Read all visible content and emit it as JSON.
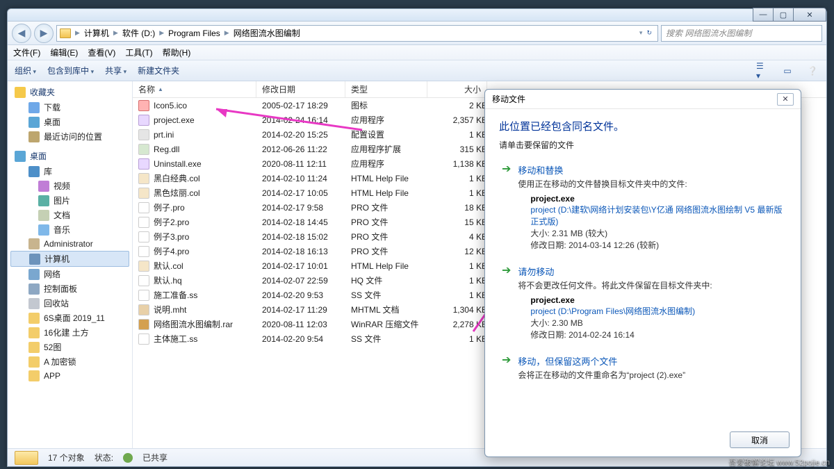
{
  "window_controls": {
    "min": "—",
    "max": "▢",
    "close": "✕"
  },
  "breadcrumbs": [
    "计算机",
    "软件 (D:)",
    "Program Files",
    "网络图流水图编制"
  ],
  "search_placeholder": "搜索 网络图流水图编制",
  "menu": {
    "file": "文件(F)",
    "edit": "编辑(E)",
    "view": "查看(V)",
    "tools": "工具(T)",
    "help": "帮助(H)"
  },
  "toolbar": {
    "organize": "组织",
    "include": "包含到库中",
    "share": "共享",
    "newfolder": "新建文件夹"
  },
  "sidebar": {
    "favorites": "收藏夹",
    "downloads": "下载",
    "desktop": "桌面",
    "recent": "最近访问的位置",
    "desktop_hdr": "桌面",
    "library": "库",
    "video": "视频",
    "pictures": "图片",
    "documents": "文档",
    "music": "音乐",
    "admin": "Administrator",
    "computer": "计算机",
    "network": "网络",
    "panel": "控制面板",
    "trash": "回收站",
    "f1": "6S桌面 2019_11",
    "f2": "16化建 土方",
    "f3": "52图",
    "f4": "A 加密锁",
    "f5": "APP"
  },
  "columns": {
    "name": "名称",
    "date": "修改日期",
    "type": "类型",
    "size": "大小"
  },
  "files": [
    {
      "icon": "ico",
      "name": "Icon5.ico",
      "date": "2005-02-17 18:29",
      "type": "图标",
      "size": "2 KB"
    },
    {
      "icon": "exe",
      "name": "project.exe",
      "date": "2014-02-24 16:14",
      "type": "应用程序",
      "size": "2,357 KB"
    },
    {
      "icon": "ini",
      "name": "prt.ini",
      "date": "2014-02-20 15:25",
      "type": "配置设置",
      "size": "1 KB"
    },
    {
      "icon": "dll",
      "name": "Reg.dll",
      "date": "2012-06-26 11:22",
      "type": "应用程序扩展",
      "size": "315 KB"
    },
    {
      "icon": "exe",
      "name": "Uninstall.exe",
      "date": "2020-08-11 12:11",
      "type": "应用程序",
      "size": "1,138 KB"
    },
    {
      "icon": "html",
      "name": "黑白经典.col",
      "date": "2014-02-10 11:24",
      "type": "HTML Help File",
      "size": "1 KB"
    },
    {
      "icon": "html",
      "name": "黑色炫丽.col",
      "date": "2014-02-17 10:05",
      "type": "HTML Help File",
      "size": "1 KB"
    },
    {
      "icon": "pro",
      "name": "例子.pro",
      "date": "2014-02-17 9:58",
      "type": "PRO 文件",
      "size": "18 KB"
    },
    {
      "icon": "pro",
      "name": "例子2.pro",
      "date": "2014-02-18 14:45",
      "type": "PRO 文件",
      "size": "15 KB"
    },
    {
      "icon": "pro",
      "name": "例子3.pro",
      "date": "2014-02-18 15:02",
      "type": "PRO 文件",
      "size": "4 KB"
    },
    {
      "icon": "pro",
      "name": "例子4.pro",
      "date": "2014-02-18 16:13",
      "type": "PRO 文件",
      "size": "12 KB"
    },
    {
      "icon": "html",
      "name": "默认.col",
      "date": "2014-02-17 10:01",
      "type": "HTML Help File",
      "size": "1 KB"
    },
    {
      "icon": "pro",
      "name": "默认.hq",
      "date": "2014-02-07 22:59",
      "type": "HQ 文件",
      "size": "1 KB"
    },
    {
      "icon": "pro",
      "name": "施工准备.ss",
      "date": "2014-02-20 9:53",
      "type": "SS 文件",
      "size": "1 KB"
    },
    {
      "icon": "mht",
      "name": "说明.mht",
      "date": "2014-02-17 11:29",
      "type": "MHTML 文档",
      "size": "1,304 KB"
    },
    {
      "icon": "rar",
      "name": "网络图流水图编制.rar",
      "date": "2020-08-11 12:03",
      "type": "WinRAR 压缩文件",
      "size": "2,278 KB"
    },
    {
      "icon": "pro",
      "name": "主体施工.ss",
      "date": "2014-02-20 9:54",
      "type": "SS 文件",
      "size": "1 KB"
    }
  ],
  "status": {
    "count": "17 个对象",
    "state_label": "状态:",
    "shared": "已共享"
  },
  "dialog": {
    "title": "移动文件",
    "heading": "此位置已经包含同名文件。",
    "sub": "请单击要保留的文件",
    "opt1_title": "移动和替换",
    "opt1_desc": "使用正在移动的文件替换目标文件夹中的文件:",
    "opt1_file": "project.exe",
    "opt1_path": "project (D:\\建软\\网络计划安装包\\Y亿通 网络图流水图绘制 V5 最新版 正式版)",
    "opt1_size": "大小: 2.31 MB (较大)",
    "opt1_date": "修改日期: 2014-03-14 12:26 (较新)",
    "opt2_title": "请勿移动",
    "opt2_desc": "将不会更改任何文件。将此文件保留在目标文件夹中:",
    "opt2_file": "project.exe",
    "opt2_path": "project (D:\\Program Files\\网络图流水图编制)",
    "opt2_size": "大小: 2.30 MB",
    "opt2_date": "修改日期: 2014-02-24 16:14",
    "opt3_title": "移动，但保留这两个文件",
    "opt3_desc": "会将正在移动的文件重命名为“project (2).exe”",
    "cancel": "取消"
  },
  "watermark": "吾爱破解论坛 www.52pojie.cn"
}
